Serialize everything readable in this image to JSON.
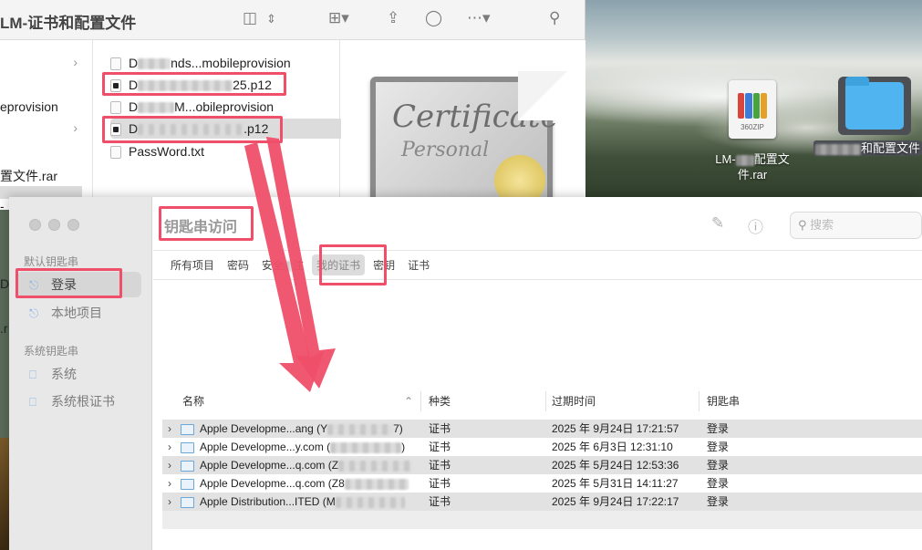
{
  "finder": {
    "title": "LM-证书和配置文件",
    "col1_items": [
      "eprovision",
      "置文件.rar"
    ],
    "files": [
      {
        "prefix": "D",
        "suffix": "nds...mobileprovision"
      },
      {
        "prefix": "D",
        "suffix": "25.p12"
      },
      {
        "prefix": "D",
        "suffix": "M...obileprovision"
      },
      {
        "prefix": "D",
        "suffix": ".p12"
      },
      {
        "prefix": "",
        "suffix": "PassWord.txt"
      }
    ],
    "preview_words": [
      "Certificate",
      "Personal"
    ]
  },
  "desktop": {
    "zip_caption": "360ZIP",
    "zip_label_a": "LM-",
    "zip_label_b": "配置文",
    "zip_label_c": "件.rar",
    "folder_label": "和配置文件"
  },
  "keychain": {
    "title": "钥匙串访问",
    "search_placeholder": "搜索",
    "sidebar": {
      "section_default": "默认钥匙串",
      "section_system": "系统钥匙串",
      "items": [
        {
          "label": "登录",
          "icon": "unlock-icon"
        },
        {
          "label": "本地项目",
          "icon": "unlock-icon"
        },
        {
          "label": "系统",
          "icon": "lock-icon"
        },
        {
          "label": "系统根证书",
          "icon": "lock-icon"
        }
      ]
    },
    "tabs": [
      "所有项目",
      "密码",
      "安全",
      "注",
      "我的证书",
      "密钥",
      "证书"
    ],
    "columns": [
      "名称",
      "种类",
      "过期时间",
      "钥匙串"
    ],
    "rows": [
      {
        "name": "Apple Developme...ang (Y",
        "tail": "7)",
        "kind": "证书",
        "expires": "2025 年 9月24日 17:21:57",
        "keychain": "登录"
      },
      {
        "name": "Apple Developme...y.com (",
        "tail": ")",
        "kind": "证书",
        "expires": "2025 年 6月3日 12:31:10",
        "keychain": "登录"
      },
      {
        "name": "Apple Developme...q.com (Z",
        "tail": "",
        "kind": "证书",
        "expires": "2025 年 5月24日 12:53:36",
        "keychain": "登录"
      },
      {
        "name": "Apple Developme...q.com (Z8",
        "tail": "",
        "kind": "证书",
        "expires": "2025 年 5月31日 14:11:27",
        "keychain": "登录"
      },
      {
        "name": "Apple Distribution...ITED (M",
        "tail": "",
        "kind": "证书",
        "expires": "2025 年 9月24日 17:22:17",
        "keychain": "登录"
      }
    ]
  },
  "left_edge_text": [
    "D",
    "-",
    ".r",
    "ts"
  ],
  "colors": {
    "annotation": "#ef4f69",
    "accent": "#4fb4ef"
  }
}
